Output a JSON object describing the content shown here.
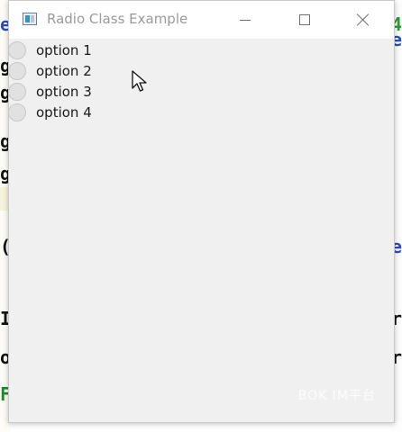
{
  "window": {
    "title": "Radio Class Example",
    "controls": {
      "minimize": "minimize",
      "maximize": "maximize",
      "close": "close"
    }
  },
  "radio_buttons": [
    {
      "label": "option 1",
      "checked": false
    },
    {
      "label": "option 2",
      "checked": false
    },
    {
      "label": "option 3",
      "checked": false
    },
    {
      "label": "option 4",
      "checked": false
    }
  ],
  "background_fragments": {
    "left": [
      "e",
      "g",
      "g",
      "g",
      "g",
      "(",
      "I",
      "o",
      "F"
    ],
    "right": [
      "4",
      "e",
      "e",
      "r",
      "r"
    ]
  },
  "watermark": "BOK IM平台",
  "colors": {
    "window_bg": "#f0f0f0",
    "titlebar_bg": "#ffffff",
    "title_text": "#9a9a9a",
    "radio_fill": "#e1e1e1"
  }
}
